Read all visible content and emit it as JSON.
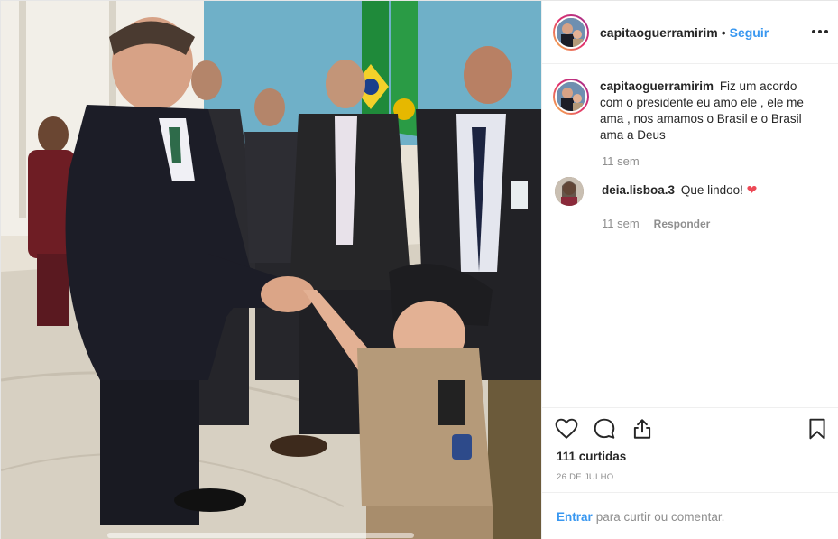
{
  "post": {
    "username": "capitaoguerramirim",
    "separator": "•",
    "follow_label": "Seguir",
    "caption": "Fiz um acordo com o presidente eu amo ele , ele me ama , nos amamos o Brasil e o Brasil ama a Deus",
    "caption_time": "11 sem"
  },
  "comments": [
    {
      "username": "deia.lisboa.3",
      "text": "Que lindoo!",
      "emoji": "❤",
      "time": "11 sem",
      "reply_label": "Responder"
    }
  ],
  "actions": {
    "icons": [
      "heart-outline-icon",
      "comment-bubble-icon",
      "share-icon",
      "bookmark-icon"
    ],
    "likes_text": "111 curtidas",
    "date_text": "26 DE JULHO"
  },
  "comment_bar": {
    "login_label": "Entrar",
    "hint_text": "para curtir ou comentar."
  },
  "colors": {
    "link": "#3897f0",
    "heart": "#ed4956",
    "muted": "#8e8e8e",
    "text": "#262626"
  }
}
